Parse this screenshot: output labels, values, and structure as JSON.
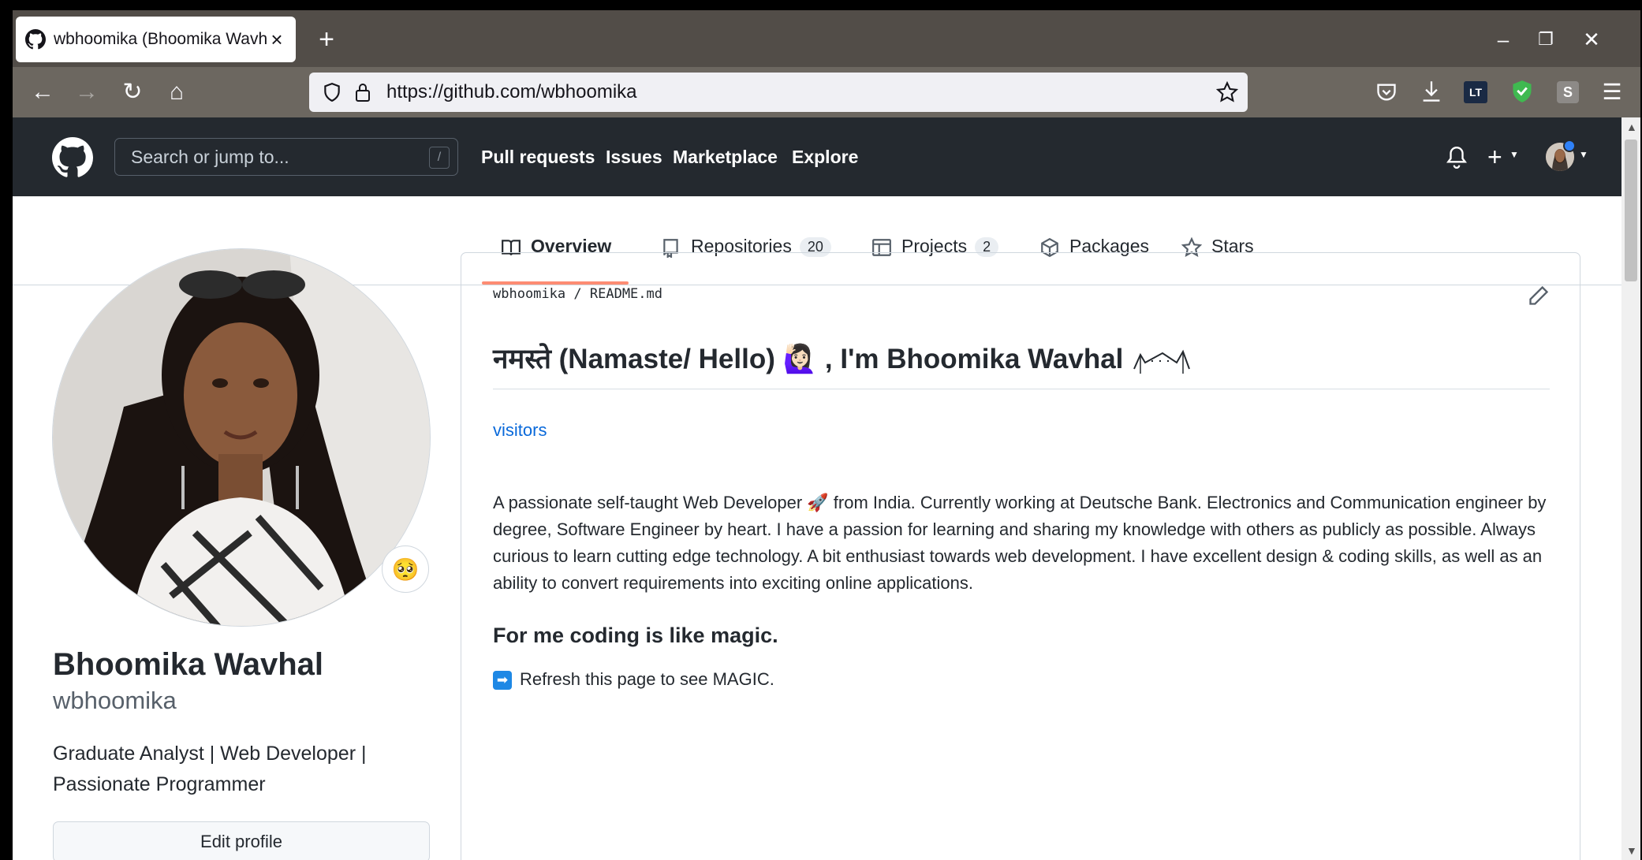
{
  "browser": {
    "tab_title": "wbhoomika (Bhoomika Wavhal)",
    "tab_close": "×",
    "new_tab": "+",
    "url": "https://github.com/wbhoomika"
  },
  "github_header": {
    "search_placeholder": "Search or jump to...",
    "search_shortcut": "/",
    "nav": [
      "Pull requests",
      "Issues",
      "Marketplace",
      "Explore"
    ]
  },
  "profile_tabs": [
    {
      "label": "Overview",
      "selected": true,
      "icon": "book-icon"
    },
    {
      "label": "Repositories",
      "count": "20",
      "icon": "repo-icon"
    },
    {
      "label": "Projects",
      "count": "2",
      "icon": "project-icon"
    },
    {
      "label": "Packages",
      "icon": "package-icon"
    },
    {
      "label": "Stars",
      "icon": "star-icon"
    }
  ],
  "profile": {
    "name": "Bhoomika Wavhal",
    "login": "wbhoomika",
    "bio": "Graduate Analyst | Web Developer | Passionate Programmer",
    "edit_button": "Edit profile",
    "status_emoji": "🥺"
  },
  "readme": {
    "path_user": "wbhoomika",
    "path_sep": "/",
    "path_file": "README.md",
    "heading": "नमस्ते (Namaste/ Hello) 🙋🏻‍♀️ , I'm Bhoomika Wavhal",
    "visitors_link": "visitors",
    "paragraph": "A passionate self-taught Web Developer 🚀 from India. Currently working at Deutsche Bank. Electronics and Communication engineer by degree, Software Engineer by heart. I have a passion for learning and sharing my knowledge with others as publicly as possible. Always curious to learn cutting edge technology. A bit enthusiast towards web development. I have excellent design & coding skills, as well as an ability to convert requirements into exciting online applications.",
    "subheading": "For me coding is like magic.",
    "magic_line": "Refresh this page to see MAGIC.",
    "magic_arrow": "➡"
  },
  "colors": {
    "github_header_bg": "#24292f",
    "tab_underline": "#fd8c73",
    "link": "#0969da"
  }
}
